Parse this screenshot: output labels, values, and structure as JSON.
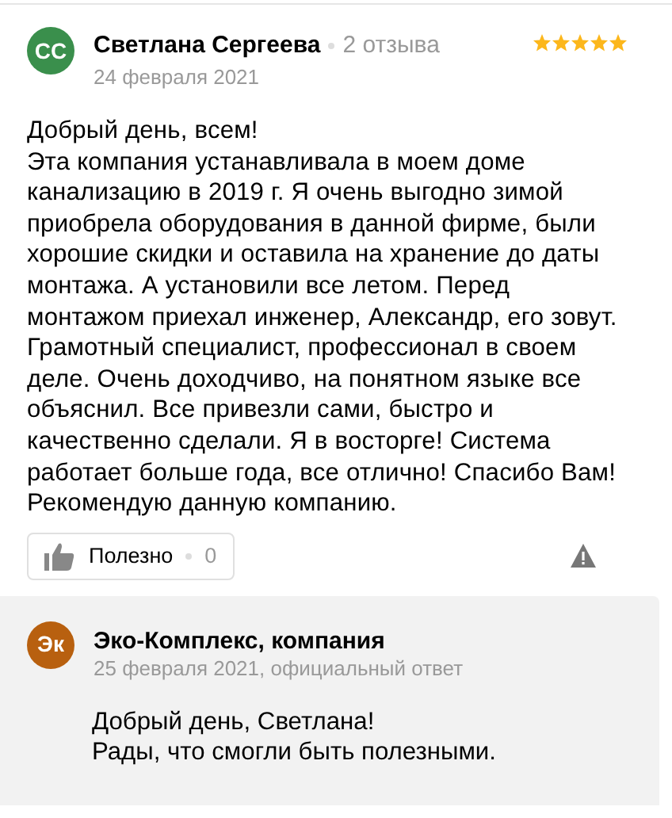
{
  "review": {
    "avatar": "СС",
    "author": "Светлана Сергеева",
    "reviews_count": "2 отзыва",
    "date": "24 февраля 2021",
    "stars": 5,
    "paragraphs": [
      "Добрый день, всем!",
      "Эта компания устанавливала в моем доме канализацию в 2019 г. Я очень выгодно зимой приобрела оборудования в данной фирме, были хорошие скидки и оставила на хранение до даты монтажа. А установили все летом. Перед монтажом приехал инженер, Александр, его зовут. Грамотный специалист, профессионал в своем деле. Очень доходчиво, на понятном языке все объяснил. Все привезли сами, быстро и качественно сделали. Я в восторге! Система работает больше года, все отлично! Спасибо Вам! Рекомендую данную компанию."
    ],
    "helpful": {
      "label": "Полезно",
      "count": "0"
    }
  },
  "reply": {
    "avatar": "Эк",
    "author": "Эко-Комплекс, компания",
    "date": "25 февраля 2021, официальный ответ",
    "lines": [
      "Добрый день, Светлана!",
      "Рады, что смогли быть полезными."
    ]
  }
}
